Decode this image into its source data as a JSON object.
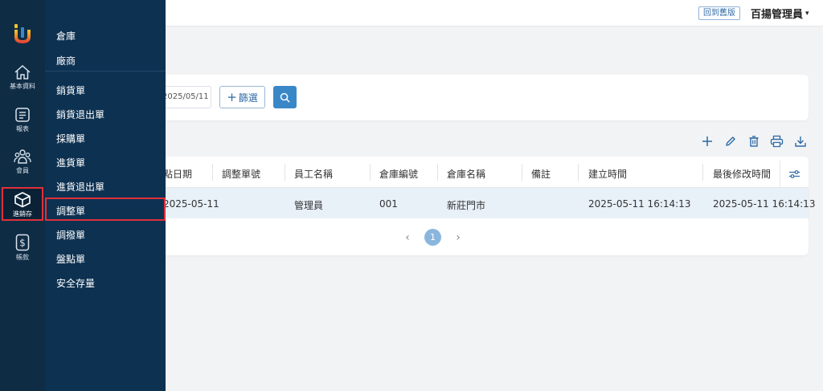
{
  "header": {
    "old_version_label": "回到舊版",
    "user_name": "百揚管理員",
    "caret": "▾"
  },
  "rail": {
    "items": [
      {
        "label": "基本資料",
        "icon": "home-icon"
      },
      {
        "label": "報表",
        "icon": "report-icon"
      },
      {
        "label": "會員",
        "icon": "members-icon"
      },
      {
        "label": "進銷存",
        "icon": "box-icon",
        "active": true
      },
      {
        "label": "帳款",
        "icon": "dollar-icon"
      }
    ]
  },
  "submenu": {
    "items": [
      {
        "label": "倉庫"
      },
      {
        "label": "廠商"
      },
      {
        "label": "銷貨單"
      },
      {
        "label": "銷貨退出單"
      },
      {
        "label": "採購單"
      },
      {
        "label": "進貨單"
      },
      {
        "label": "進貨退出單"
      },
      {
        "label": "調整單",
        "active": true
      },
      {
        "label": "調撥單"
      },
      {
        "label": "盤點單"
      },
      {
        "label": "安全存量"
      }
    ]
  },
  "filter": {
    "date_value": "2025/05/11",
    "filter_button_plus": "+",
    "filter_button_label": "篩選"
  },
  "table": {
    "columns": [
      "點日期",
      "調整單號",
      "員工名稱",
      "倉庫編號",
      "倉庫名稱",
      "備註",
      "建立時間",
      "最後修改時間"
    ],
    "rows": [
      [
        "2025-05-11",
        "",
        "管理員",
        "001",
        "新莊門市",
        "",
        "2025-05-11 16:14:13",
        "2025-05-11 16:14:13"
      ]
    ]
  },
  "pagination": {
    "prev": "‹",
    "current_page": "1",
    "next": "›"
  },
  "colors": {
    "rail_bg": "#0f2c45",
    "submenu_bg": "#0d3151",
    "accent": "#3a87c8",
    "highlight_border": "#e0303a",
    "selected_row": "#e8f0f8"
  }
}
